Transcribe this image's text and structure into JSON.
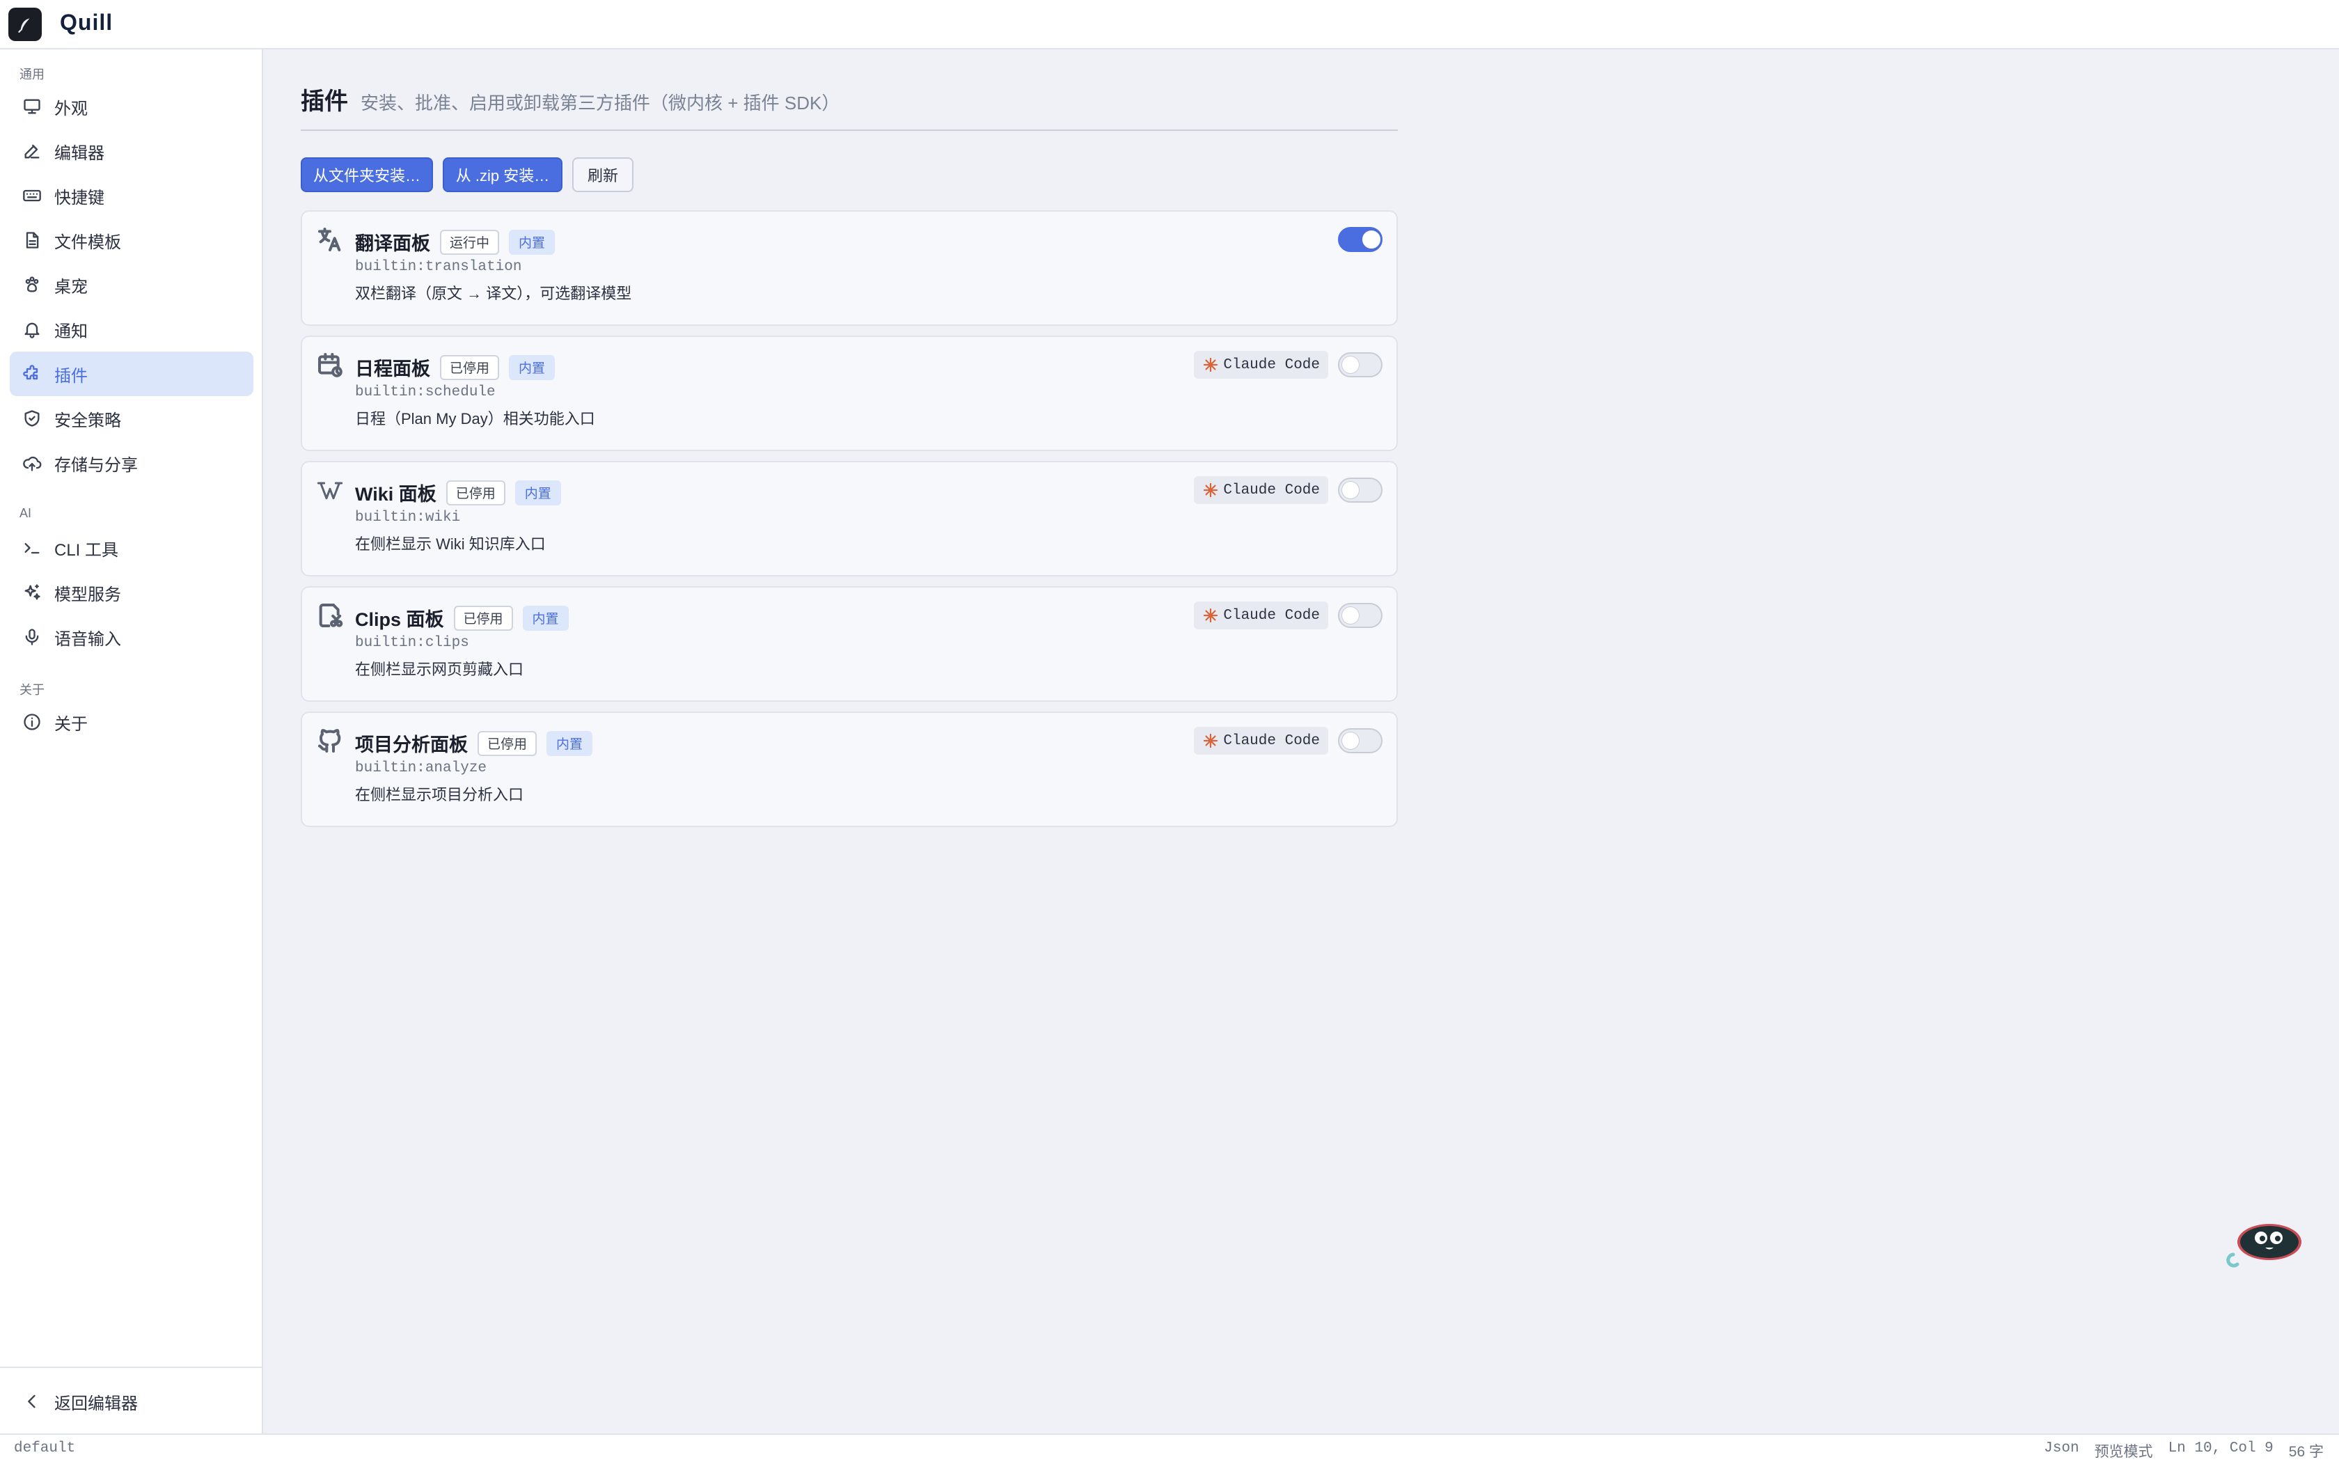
{
  "app": {
    "name": "Quill"
  },
  "colors": {
    "accent": "#4a6ee0",
    "background": "#eff1f7",
    "toggle_on": "#4a6ee0"
  },
  "sidebar": {
    "sections": [
      {
        "title": "通用"
      },
      {
        "title": "AI"
      },
      {
        "title": "关于"
      }
    ],
    "items": [
      {
        "label": "外观",
        "icon": "monitor-icon"
      },
      {
        "label": "编辑器",
        "icon": "edit-icon"
      },
      {
        "label": "快捷键",
        "icon": "keyboard-icon"
      },
      {
        "label": "文件模板",
        "icon": "file-template-icon"
      },
      {
        "label": "桌宠",
        "icon": "pet-paw-icon"
      },
      {
        "label": "通知",
        "icon": "bell-icon"
      },
      {
        "label": "插件",
        "icon": "puzzle-icon",
        "active": true
      },
      {
        "label": "安全策略",
        "icon": "shield-icon"
      },
      {
        "label": "存储与分享",
        "icon": "cloud-share-icon"
      },
      {
        "label": "CLI 工具",
        "icon": "terminal-icon"
      },
      {
        "label": "模型服务",
        "icon": "sparkles-icon"
      },
      {
        "label": "语音输入",
        "icon": "microphone-icon"
      },
      {
        "label": "关于",
        "icon": "info-icon"
      }
    ],
    "back_label": "返回编辑器"
  },
  "main": {
    "title": "插件",
    "subtitle": "安装、批准、启用或卸载第三方插件（微内核 + 插件 SDK）",
    "buttons": {
      "install_folder": "从文件夹安装…",
      "install_zip": "从 .zip 安装…",
      "refresh": "刷新"
    },
    "plugins": [
      {
        "name": "翻译面板",
        "status": "运行中",
        "builtin": "内置",
        "id": "builtin:translation",
        "desc": "双栏翻译（原文 → 译文），可选翻译模型",
        "icon": "translate-icon",
        "enabled": true,
        "agent": ""
      },
      {
        "name": "日程面板",
        "status": "已停用",
        "builtin": "内置",
        "id": "builtin:schedule",
        "desc": "日程（Plan My Day）相关功能入口",
        "icon": "calendar-icon",
        "enabled": false,
        "agent": "Claude Code"
      },
      {
        "name": "Wiki 面板",
        "status": "已停用",
        "builtin": "内置",
        "id": "builtin:wiki",
        "desc": "在侧栏显示 Wiki 知识库入口",
        "icon": "wikipedia-icon",
        "enabled": false,
        "agent": "Claude Code"
      },
      {
        "name": "Clips 面板",
        "status": "已停用",
        "builtin": "内置",
        "id": "builtin:clips",
        "desc": "在侧栏显示网页剪藏入口",
        "icon": "clip-icon",
        "enabled": false,
        "agent": "Claude Code"
      },
      {
        "name": "项目分析面板",
        "status": "已停用",
        "builtin": "内置",
        "id": "builtin:analyze",
        "desc": "在侧栏显示项目分析入口",
        "icon": "github-icon",
        "enabled": false,
        "agent": "Claude Code"
      }
    ]
  },
  "statusbar": {
    "profile": "default",
    "format": "Json",
    "mode": "预览模式",
    "position": "Ln 10, Col 9",
    "count": "56 字"
  }
}
